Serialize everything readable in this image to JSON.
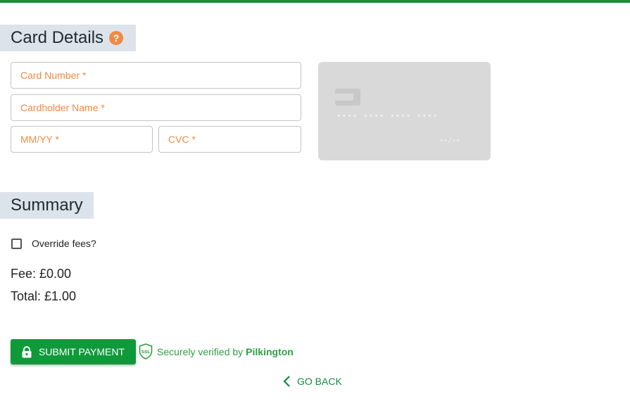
{
  "colors": {
    "accent_green": "#0f9a3a",
    "top_bar": "#1e8a3c",
    "placeholder_orange": "#ef8a45",
    "section_header_bg": "#dde3ea"
  },
  "card_details": {
    "title": "Card Details",
    "help_icon": "help-icon",
    "help_symbol": "?",
    "card_number_placeholder": "Card Number *",
    "cardholder_name_placeholder": "Cardholder Name *",
    "expiry_placeholder": "MM/YY *",
    "cvc_placeholder": "CVC *",
    "preview": {
      "number_mask": "•••• •••• •••• ••••",
      "expiry_mask": "••/••"
    }
  },
  "summary": {
    "title": "Summary",
    "override_fees_label": "Override fees?",
    "override_fees_checked": false,
    "fee_text": "Fee: £0.00",
    "total_text": "Total: £1.00"
  },
  "actions": {
    "submit_label": "SUBMIT PAYMENT",
    "submit_icon": "lock-icon",
    "ssl_icon": "ssl-shield-icon",
    "secure_text": "Securely verified by",
    "secure_brand": "Pilkington",
    "go_back_label": "GO BACK",
    "go_back_icon": "chevron-left-icon"
  }
}
